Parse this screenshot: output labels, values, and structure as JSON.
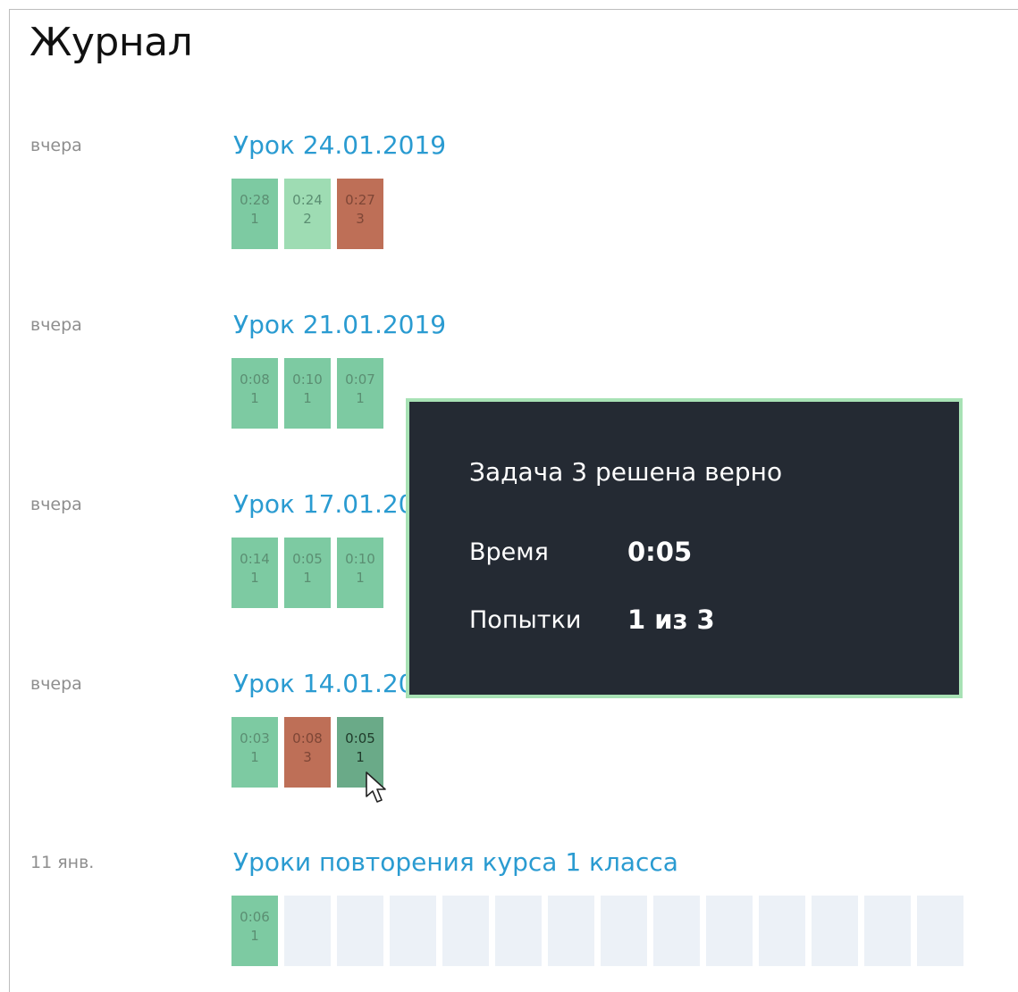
{
  "page": {
    "title": "Журнал"
  },
  "lessons": [
    {
      "date": "вчера",
      "title": "Урок 24.01.2019",
      "tasks": [
        {
          "time": "0:28",
          "attempts": "1"
        },
        {
          "time": "0:24",
          "attempts": "2"
        },
        {
          "time": "0:27",
          "attempts": "3"
        }
      ]
    },
    {
      "date": "вчера",
      "title": "Урок 21.01.2019",
      "tasks": [
        {
          "time": "0:08",
          "attempts": "1"
        },
        {
          "time": "0:10",
          "attempts": "1"
        },
        {
          "time": "0:07",
          "attempts": "1"
        }
      ]
    },
    {
      "date": "вчера",
      "title": "Урок 17.01.2019",
      "tasks": [
        {
          "time": "0:14",
          "attempts": "1"
        },
        {
          "time": "0:05",
          "attempts": "1"
        },
        {
          "time": "0:10",
          "attempts": "1"
        }
      ]
    },
    {
      "date": "вчера",
      "title": "Урок 14.01.2019",
      "tasks": [
        {
          "time": "0:03",
          "attempts": "1"
        },
        {
          "time": "0:08",
          "attempts": "3"
        },
        {
          "time": "0:05",
          "attempts": "1"
        }
      ]
    },
    {
      "date": "11 янв.",
      "title": "Уроки повторения курса 1 класса",
      "tasks": [
        {
          "time": "0:06",
          "attempts": "1"
        }
      ]
    }
  ],
  "tooltip": {
    "title": "Задача 3 решена верно",
    "time_label": "Время",
    "time_value": "0:05",
    "attempts_label": "Попытки",
    "attempts_value": "1 из 3"
  },
  "colors": {
    "correct": "#7dcaa2",
    "correct_light": "#9edcb3",
    "wrong": "#be6f57",
    "hovered": "#6aaa88",
    "unsolved": "#ecf1f7",
    "link": "#2a9bd1",
    "tooltip_bg": "#242a33",
    "tooltip_border": "#a8e2b5"
  }
}
